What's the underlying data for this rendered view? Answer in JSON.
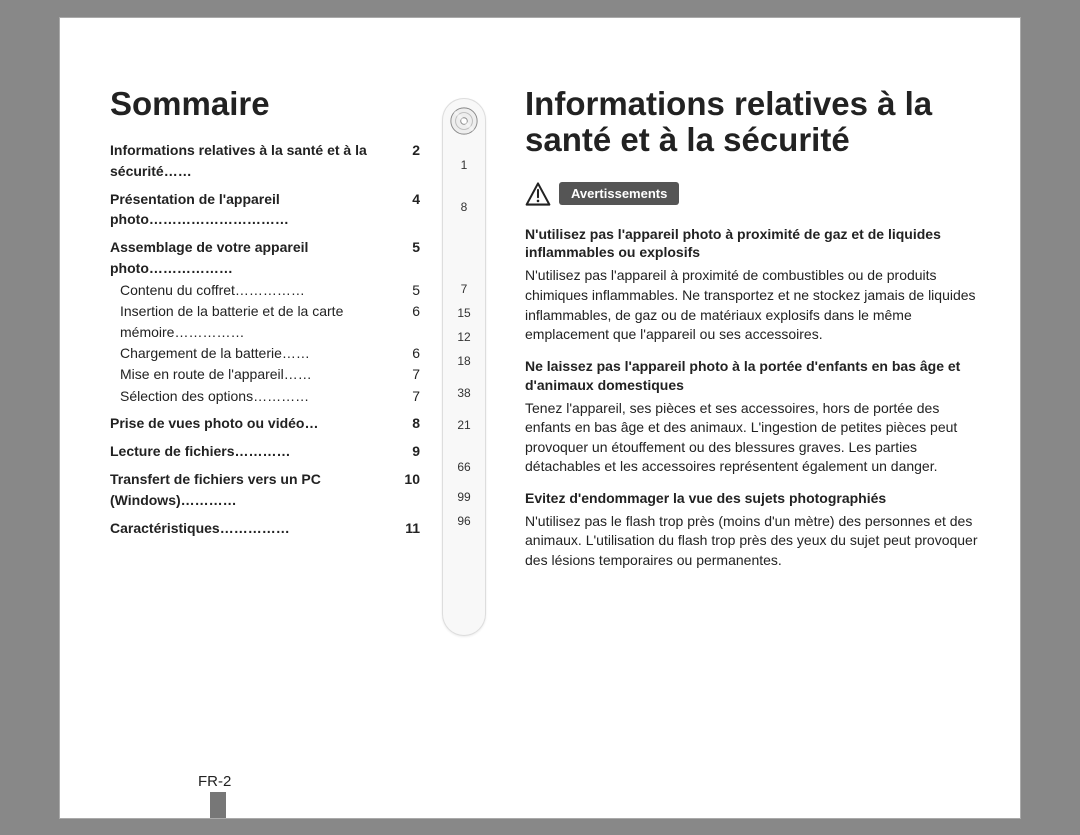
{
  "left": {
    "heading": "Sommaire",
    "toc": [
      {
        "type": "main",
        "label": "Informations relatives à la santé et à la sécurité",
        "trail": "……",
        "page": "2",
        "cd": "1"
      },
      {
        "type": "main",
        "label": "Présentation de l'appareil photo",
        "trail": "…………………………",
        "page": "4",
        "cd": "8"
      },
      {
        "type": "main",
        "label": "Assemblage de votre appareil photo",
        "trail": "………………",
        "page": "5",
        "cd": ""
      },
      {
        "type": "sub",
        "label": "Contenu du coffret",
        "trail": "……………",
        "page": "5",
        "cd": "7"
      },
      {
        "type": "sub",
        "label": "Insertion de la batterie et de la carte mémoire",
        "trail": "……………",
        "page": "6",
        "cd": "15"
      },
      {
        "type": "sub",
        "label": "Chargement de la batterie",
        "trail": "……",
        "page": "6",
        "cd": "12"
      },
      {
        "type": "sub",
        "label": "Mise en route de l'appareil",
        "trail": "……",
        "page": "7",
        "cd": "18"
      },
      {
        "type": "sub",
        "label": "Sélection des options",
        "trail": "…………",
        "page": "7",
        "cd": "38"
      },
      {
        "type": "main",
        "label": "Prise de vues photo ou vidéo",
        "trail": "…",
        "page": "8",
        "cd": "21"
      },
      {
        "type": "main",
        "label": "Lecture de fichiers",
        "trail": "…………",
        "page": "9",
        "cd": "66"
      },
      {
        "type": "main",
        "label": "Transfert de fichiers vers un PC (Windows)",
        "trail": "…………",
        "page": "10",
        "cd": "99"
      },
      {
        "type": "main",
        "label": "Caractéristiques",
        "trail": "……………",
        "page": "11",
        "cd": "96"
      }
    ]
  },
  "right": {
    "heading": "Informations relatives à la santé et à la sécurité",
    "warn_label": "Avertissements",
    "sections": [
      {
        "head": "N'utilisez pas l'appareil photo à proximité de gaz et de liquides inflammables ou explosifs",
        "body": "N'utilisez pas l'appareil à proximité de combustibles ou de produits chimiques inflammables. Ne transportez et ne stockez jamais de liquides inflammables, de gaz ou de matériaux explosifs dans le même emplacement que l'appareil ou ses accessoires."
      },
      {
        "head": "Ne laissez pas l'appareil photo à la portée d'enfants en bas âge et d'animaux domestiques",
        "body": "Tenez l'appareil, ses pièces et ses accessoires, hors de portée des enfants en bas âge et des animaux. L'ingestion de petites pièces peut provoquer un étouffement ou des blessures graves. Les parties détachables et les accessoires représentent également un danger."
      },
      {
        "head": "Evitez d'endommager la vue des sujets photographiés",
        "body": "N'utilisez pas le flash trop près (moins d'un mètre) des personnes et des animaux. L'utilisation du flash trop près des yeux du sujet peut provoquer des lésions temporaires ou permanentes."
      }
    ]
  },
  "footer": "FR-2"
}
